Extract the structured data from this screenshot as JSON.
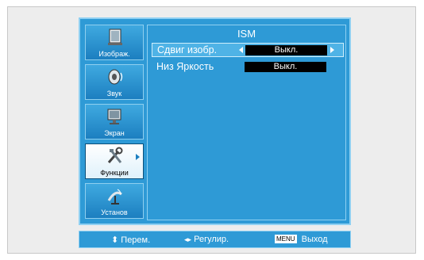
{
  "sidebar": {
    "items": [
      {
        "label": "Изображ.",
        "icon": "picture-icon",
        "active": false
      },
      {
        "label": "Звук",
        "icon": "sound-icon",
        "active": false
      },
      {
        "label": "Экран",
        "icon": "screen-icon",
        "active": false
      },
      {
        "label": "Функции",
        "icon": "functions-icon",
        "active": true
      },
      {
        "label": "Установ",
        "icon": "setup-icon",
        "active": false
      }
    ]
  },
  "panel": {
    "title": "ISM",
    "rows": [
      {
        "label": "Сдвиг изобр.",
        "value": "Выкл.",
        "selected": true
      },
      {
        "label": "Низ Яркость",
        "value": "Выкл.",
        "selected": false
      }
    ]
  },
  "footer": {
    "move": "Перем.",
    "adjust": "Регулир.",
    "menu_key": "MENU",
    "exit": "Выход"
  },
  "colors": {
    "osd_background": "#2e9ad6",
    "osd_border": "#8fd0f2",
    "value_box": "#000000",
    "text": "#ffffff"
  }
}
